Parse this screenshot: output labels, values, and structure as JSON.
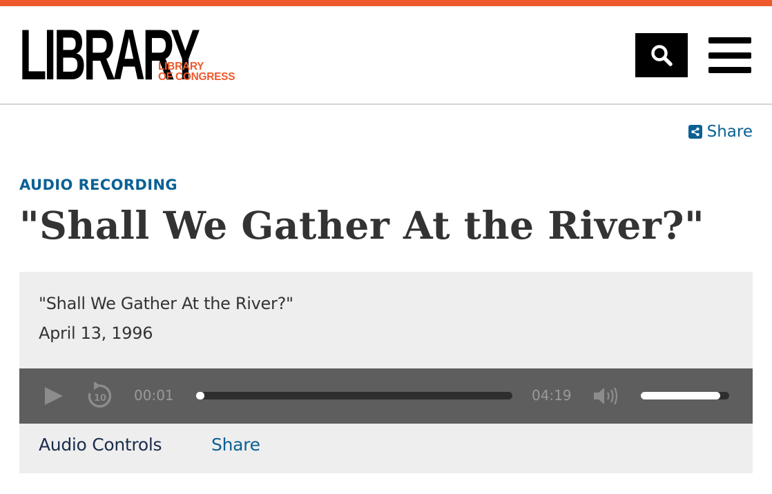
{
  "brand": {
    "logo_main": "LIBRARY",
    "logo_sub_line1": "LIBRARY",
    "logo_sub_line2": "OF CONGRESS",
    "accent_color": "#ee5a2b",
    "link_color": "#0b6194"
  },
  "header": {
    "search_icon": "search-icon",
    "menu_icon": "hamburger-menu-icon"
  },
  "share_top": {
    "label": "Share",
    "icon": "share-icon"
  },
  "item": {
    "format": "AUDIO RECORDING",
    "title": "\"Shall We Gather At the River?\""
  },
  "media": {
    "title": "\"Shall We Gather At the River?\"",
    "date": "April 13, 1996",
    "player": {
      "play_icon": "play-icon",
      "rewind_icon": "rewind-10-icon",
      "rewind_label": "10",
      "current_time": "00:01",
      "duration": "04:19",
      "progress_fraction": 0.004,
      "volume_icon": "volume-icon",
      "volume_fraction": 0.9
    },
    "tabs": [
      {
        "label": "Audio Controls"
      },
      {
        "label": "Share"
      }
    ]
  }
}
